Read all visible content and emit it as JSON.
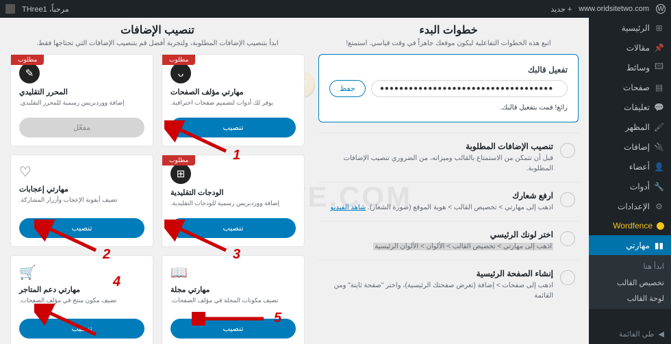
{
  "adminbar": {
    "site": "www.oridsitetwo.com",
    "new": "جديد",
    "greeting": "مرحباً، THree1"
  },
  "sidebar": {
    "dashboard": "الرئيسية",
    "posts": "مقالات",
    "media": "وسائط",
    "pages": "صفحات",
    "comments": "تعليقات",
    "appearance": "المظهر",
    "plugins": "إضافات",
    "users": "أعضاء",
    "tools": "أدوات",
    "settings": "الإعدادات",
    "wordfence": "Wordfence",
    "meharty": "مهارتي",
    "sub_head": "ابدأ هنا",
    "sub_customize": "تخصيص القالب",
    "sub_dashboard": "لوحة القالب",
    "collapse": "طي القائمة"
  },
  "steps_section": {
    "title": "خطوات البدء",
    "subtitle": "اتبع هذه الخطوات التفاعلية ليكون موقعك جاهزاً في وقت قياسي. استمتع!"
  },
  "token": {
    "title": "تفعيل قالبك",
    "value": "●●●●●●●●●●●●●●●●●●●●●●●●●●●●●●●●●●●●",
    "button": "حفظ",
    "message": "رائع! قمت بتفعيل قالبك."
  },
  "steps": [
    {
      "title": "تنصيب الإضافات المطلوبة",
      "desc": "قبل أن تتمكن من الاستمتاع بالقالب وميزاته، من الضروري تنصيب الإضافات المطلوبة."
    },
    {
      "title": "ارفع شعارك",
      "desc_pre": "اذهب إلى مهارتي > تخصيص القالب > هوية الموقع (صورة الشعار). ",
      "link": "شاهد الفيديو"
    },
    {
      "title": "اختر لونك الرئيسي",
      "desc_hl": "اذهب إلى مهارتي > تخصيص القالب > الألوان > الألوان الرئيسية"
    },
    {
      "title": "إنشاء الصفحة الرئيسية",
      "desc": "اذهب إلى صفحات > إضافة (تعرض صفحتك الرئيسية)، واختر \"صفحة ثابتة\" ومن القائمة"
    }
  ],
  "plugins_section": {
    "title": "تنصيب الإضافات",
    "subtitle": "ابدأ بتنصيب الإضافات المطلوبة، ولتجربة أفضل قم بتنصيب الإضافات التي تحتاجها فقط.",
    "required_label": "مطلوب",
    "install": "تنصيب",
    "activated": "مفعّل"
  },
  "plugins": [
    {
      "title": "مهارتي مؤلف الصفحات",
      "desc": "يوفر لك أدوات لتصميم صفحات احترافية."
    },
    {
      "title": "المحرر التقليدي",
      "desc": "إضافة ووردبريس رسمية للمحرر التقليدي."
    },
    {
      "title": "الودجات التقليدية",
      "desc": "إضافة ووردبريس رسمية للودجات التقليدية."
    },
    {
      "title": "مهارتي إعجابات",
      "desc": "تضيف أيقونة الإعجاب وأزرار المشاركة."
    },
    {
      "title": "مهارتي مجلة",
      "desc": "تضيف مكونات المجلة في مؤلف الصفحات."
    },
    {
      "title": "مهارتي دعم المتاجر",
      "desc": "تضيف مكون منتج في مؤلف الصفحات."
    }
  ]
}
